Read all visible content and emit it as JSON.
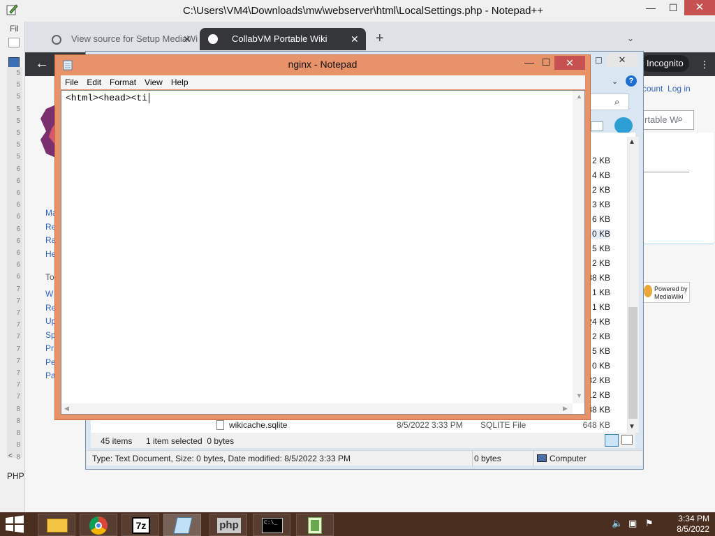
{
  "notepadpp": {
    "title": "C:\\Users\\VM4\\Downloads\\mw\\webserver\\html\\LocalSettings.php - Notepad++",
    "menu_fragment": "Fil",
    "statusbar_fragment": "PHP",
    "line_numbers": [
      "5",
      "5",
      "5",
      "5",
      "5",
      "5",
      "5",
      "5",
      "6",
      "6",
      "6",
      "6",
      "6",
      "6",
      "6",
      "6",
      "6",
      "6",
      "7",
      "7",
      "7",
      "7",
      "7",
      "7",
      "7",
      "7",
      "7",
      "7",
      "8",
      "8",
      "8",
      "8",
      "8"
    ]
  },
  "chrome": {
    "tabs": [
      {
        "label": "View source for Setup MediaWiki"
      },
      {
        "label": "CollabVM Portable Wiki"
      }
    ],
    "incognito_label": "Incognito",
    "wiki": {
      "sidebar_links": [
        "Ma",
        "Re",
        "Ra",
        "He"
      ],
      "tools_label": "To",
      "tools_links": [
        "W",
        "Re",
        "Up",
        "Sp",
        "Pr",
        "Pe",
        "Pa"
      ],
      "account_links": "count  Log in",
      "search_placeholder": "rtable W",
      "powered_by": "Powered by\nMediaWiki"
    }
  },
  "explorer": {
    "sizes": [
      "2 KB",
      "4 KB",
      "2 KB",
      "3 KB",
      "6 KB",
      "0 KB",
      "5 KB",
      "2 KB",
      "38 KB",
      "1 KB",
      "1 KB",
      "24 KB",
      "2 KB",
      "5 KB",
      "0 KB",
      "32 KB",
      "12 KB",
      "88 KB"
    ],
    "file_row": {
      "name": "wikicache.sqlite",
      "date": "8/5/2022 3:33 PM",
      "type": "SQLITE File",
      "size": "648 KB"
    },
    "status": {
      "item_count": "45 items",
      "selected": "1 item selected  0 bytes"
    },
    "details": {
      "text": "Type: Text Document, Size: 0 bytes, Date modified: 8/5/2022 3:33 PM",
      "bytes": "0 bytes",
      "location": "Computer"
    }
  },
  "notepad": {
    "title": "nginx - Notepad",
    "menu": [
      "File",
      "Edit",
      "Format",
      "View",
      "Help"
    ],
    "content": "<html><head><ti",
    "minimize": "—",
    "maximize": "☐",
    "close": "✕"
  },
  "taskbar": {
    "apps": [
      "File Explorer",
      "Google Chrome",
      "7-Zip",
      "Notepad",
      "PHP",
      "Command Prompt",
      "Notepad++"
    ],
    "clock_time": "3:34 PM",
    "clock_date": "8/5/2022"
  }
}
